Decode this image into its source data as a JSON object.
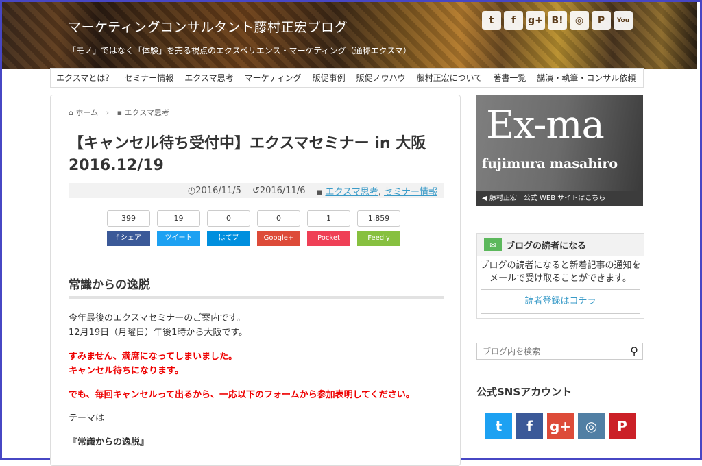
{
  "header": {
    "title": "マーケティングコンサルタント藤村正宏ブログ",
    "description": "「モノ」ではなく「体験」を売る視点のエクスペリエンス・マーケティング（通称エクスマ）",
    "sns_icons": [
      "twitter-icon",
      "facebook-icon",
      "googleplus-icon",
      "hatena-icon",
      "instagram-icon",
      "pinterest-icon",
      "youtube-icon"
    ],
    "sns_labels": [
      "t",
      "f",
      "g+",
      "B!",
      "◎",
      "P",
      "You"
    ]
  },
  "nav": [
    "エクスマとは？",
    "セミナー情報",
    "エクスマ思考",
    "マーケティング",
    "販促事例",
    "販促ノウハウ",
    "藤村正宏について",
    "著書一覧",
    "講演・執筆・コンサル依頼"
  ],
  "breadcrumb": {
    "home": "ホーム",
    "sep": "›",
    "category": "エクスマ思考"
  },
  "post": {
    "title": "【キャンセル待ち受付中】エクスマセミナー in 大阪 2016.12/19",
    "published": "2016/11/5",
    "updated": "2016/11/6",
    "cat1": "エクスマ思考",
    "cat_sep": ",",
    "cat2": "セミナー情報"
  },
  "shares": [
    {
      "count": "399",
      "label": "f シェア",
      "color": "#3b5998"
    },
    {
      "count": "19",
      "label": "ツイート",
      "color": "#1da1f2"
    },
    {
      "count": "0",
      "label": "はてブ",
      "color": "#008fde"
    },
    {
      "count": "0",
      "label": "Google+",
      "color": "#dd4b39"
    },
    {
      "count": "1",
      "label": "Pocket",
      "color": "#ef4056"
    },
    {
      "count": "1,859",
      "label": "Feedly",
      "color": "#87c040"
    }
  ],
  "body": {
    "heading": "常識からの逸脱",
    "p1a": "今年最後のエクスマセミナーのご案内です。",
    "p1b": "12月19日（月曜日）午後1時から大阪です。",
    "red1": "すみません、満席になってしまいました。",
    "red2": "キャンセル待ちになります。",
    "red3": "でも、毎回キャンセルって出るから、一応以下のフォームから参加表明してください。",
    "theme": "テーマは",
    "theme_name": "『常識からの逸脱』"
  },
  "sidebar": {
    "banner_title": "Ex-ma",
    "banner_sub": "fujimura masahiro",
    "banner_bar": "◀ 藤村正宏　公式 WEB サイトはこちら",
    "reader_head": "ブログの読者になる",
    "reader_text1": "ブログの読者になると新着記事の通知を",
    "reader_text2": "メールで受け取ることができます。",
    "reader_btn": "読者登録はコチラ",
    "search_placeholder": "ブログ内を検索",
    "sns_heading": "公式SNSアカウント",
    "sns": [
      {
        "label": "t",
        "color": "#1da1f2"
      },
      {
        "label": "f",
        "color": "#3b5998"
      },
      {
        "label": "g+",
        "color": "#dd4b39"
      },
      {
        "label": "◎",
        "color": "#517fa4"
      },
      {
        "label": "P",
        "color": "#cb2027"
      }
    ]
  }
}
